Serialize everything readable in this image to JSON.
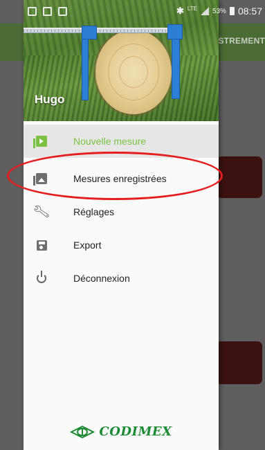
{
  "status_bar": {
    "network": "LTE",
    "battery": "53%",
    "time": "08:57"
  },
  "background_app": {
    "tab_label": "STREMENT"
  },
  "drawer": {
    "user_name": "Hugo",
    "menu": [
      {
        "label": "Nouvelle mesure",
        "icon": "new-measure-icon",
        "active": true
      },
      {
        "label": "Mesures enregistrées",
        "icon": "saved-measures-icon",
        "active": false
      },
      {
        "label": "Réglages",
        "icon": "wrench-icon",
        "active": false
      },
      {
        "label": "Export",
        "icon": "save-icon",
        "active": false
      },
      {
        "label": "Déconnexion",
        "icon": "power-icon",
        "active": false
      }
    ],
    "logo_text": "CODIMEX"
  },
  "colors": {
    "accent_green": "#7bc142",
    "logo_green": "#1d8a34",
    "annotation_red": "#e41e1e",
    "toolbar_green": "#4a6b34"
  }
}
